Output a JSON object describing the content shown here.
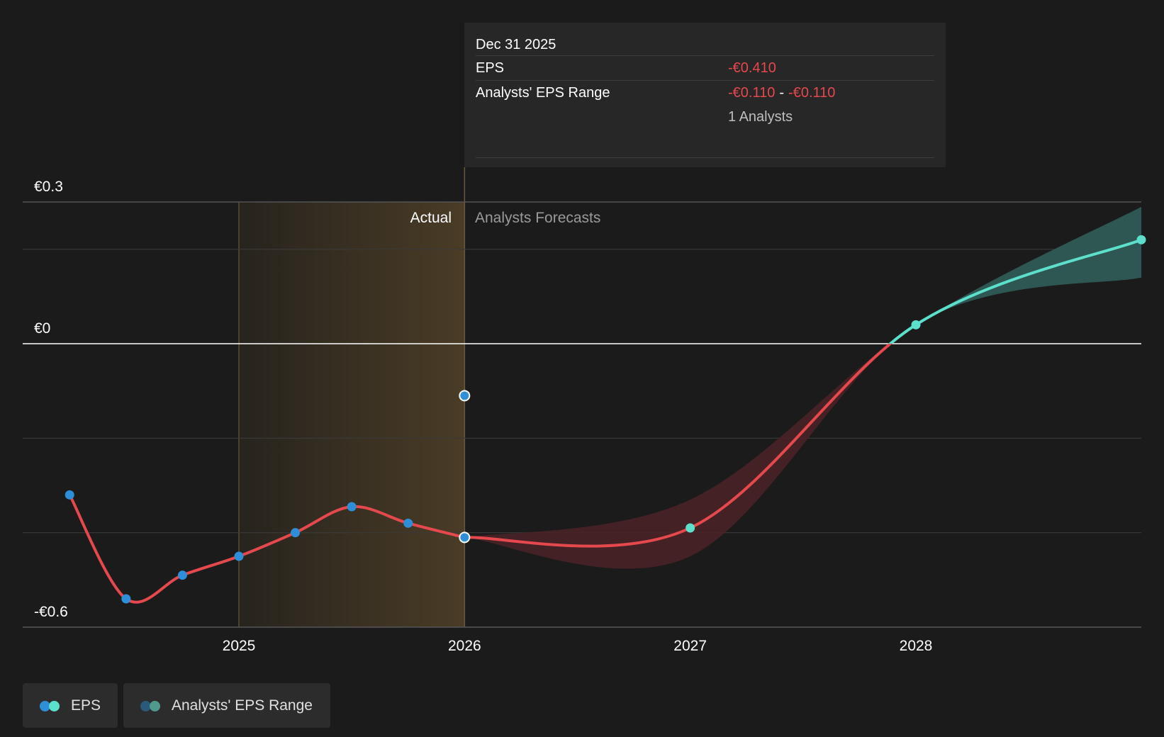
{
  "colors": {
    "background": "#1b1b1b",
    "actual_line": "#e5484d",
    "actual_marker": "#2e8ed8",
    "forecast_positive": "#5ce0cb",
    "range_band_negative": "#4a2226",
    "range_band_positive": "#2f5a55",
    "actual_shade": "#4a3c26",
    "zero_line": "#ffffff",
    "grid": "#3a3a3a"
  },
  "tooltip": {
    "date": "Dec 31 2025",
    "eps_label": "EPS",
    "eps_value": "-€0.410",
    "range_label": "Analysts' EPS Range",
    "range_low": "-€0.110",
    "range_sep": "-",
    "range_high": "-€0.110",
    "analysts": "1 Analysts"
  },
  "section_labels": {
    "actual": "Actual",
    "forecast": "Analysts Forecasts"
  },
  "legend": {
    "eps_label": "EPS",
    "range_label": "Analysts' EPS Range",
    "eps_icons": [
      "eps-actual-dot-icon",
      "eps-forecast-dot-icon"
    ],
    "range_icons": [
      "range-negative-dot-icon",
      "range-positive-dot-icon"
    ]
  },
  "chart_data": {
    "type": "line",
    "title": "",
    "xlabel": "",
    "ylabel": "",
    "ylim": [
      -0.6,
      0.3
    ],
    "y_tick_labels": [
      {
        "value": 0.3,
        "label": "€0.3"
      },
      {
        "value": 0,
        "label": "€0"
      },
      {
        "value": -0.6,
        "label": "-€0.6"
      }
    ],
    "x_tick_labels": [
      {
        "value": 2025.0,
        "label": "2025"
      },
      {
        "value": 2026.0,
        "label": "2026"
      },
      {
        "value": 2027.0,
        "label": "2027"
      },
      {
        "value": 2028.0,
        "label": "2028"
      }
    ],
    "actual_region": [
      2025.0,
      2026.0
    ],
    "grid": true,
    "series": [
      {
        "name": "EPS",
        "role": "actual",
        "x": [
          2024.25,
          2024.5,
          2024.75,
          2025.0,
          2025.25,
          2025.5,
          2025.75,
          2026.0
        ],
        "y": [
          -0.32,
          -0.54,
          -0.49,
          -0.45,
          -0.4,
          -0.345,
          -0.38,
          -0.41
        ]
      },
      {
        "name": "EPS",
        "role": "forecast",
        "x": [
          2026.0,
          2027.0,
          2028.0,
          2029.0
        ],
        "y": [
          -0.41,
          -0.39,
          0.04,
          0.22
        ]
      },
      {
        "name": "Analysts' EPS Range",
        "role": "range",
        "x": [
          2026.0,
          2027.0,
          2028.0,
          2029.0
        ],
        "low": [
          -0.41,
          -0.45,
          0.04,
          0.14
        ],
        "high": [
          -0.41,
          -0.33,
          0.04,
          0.29
        ]
      }
    ],
    "highlight_point": {
      "x": 2026.0,
      "y": -0.11
    }
  }
}
